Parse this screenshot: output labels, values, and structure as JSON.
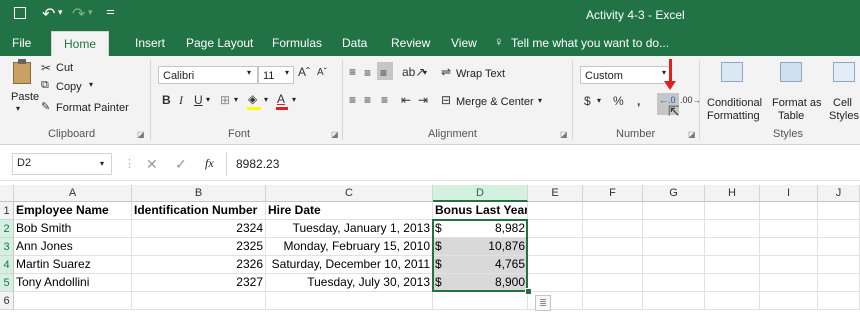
{
  "title_bar": {
    "doc_title": "Activity 4-3 - Excel"
  },
  "tabs": [
    "File",
    "Home",
    "Insert",
    "Page Layout",
    "Formulas",
    "Data",
    "Review",
    "View"
  ],
  "tell_me": "Tell me what you want to do...",
  "ribbon": {
    "clipboard": {
      "paste": "Paste",
      "cut": "Cut",
      "copy": "Copy",
      "format_painter": "Format Painter",
      "group": "Clipboard"
    },
    "font": {
      "name": "Calibri",
      "size": "11",
      "group": "Font"
    },
    "alignment": {
      "wrap_text": "Wrap Text",
      "merge_center": "Merge & Center",
      "group": "Alignment"
    },
    "number": {
      "format": "Custom",
      "group": "Number"
    },
    "styles": {
      "conditional_1": "Conditional",
      "conditional_2": "Formatting",
      "format_as_1": "Format as",
      "format_as_2": "Table",
      "cell_1": "Cell",
      "cell_2": "Styles",
      "group": "Styles"
    }
  },
  "formula_bar": {
    "name_box": "D2",
    "fx": "fx",
    "value": "8982.23"
  },
  "columns": [
    "A",
    "B",
    "C",
    "D",
    "E",
    "F",
    "G",
    "H",
    "I",
    "J"
  ],
  "rows": [
    "1",
    "2",
    "3",
    "4",
    "5",
    "6"
  ],
  "table": {
    "headers": [
      "Employee Name",
      "Identification Number",
      "Hire Date",
      "Bonus Last Year"
    ],
    "data": [
      [
        "Bob Smith",
        "2324",
        "Tuesday, January 1, 2013",
        "$",
        "8,982"
      ],
      [
        "Ann Jones",
        "2325",
        "Monday, February 15, 2010",
        "$",
        "10,876"
      ],
      [
        "Martin Suarez",
        "2326",
        "Saturday, December 10, 2011",
        "$",
        "4,765"
      ],
      [
        "Tony Andollini",
        "2327",
        "Tuesday, July 30, 2013",
        "$",
        "8,900"
      ]
    ]
  },
  "colors": {
    "excel_green": "#217346",
    "selection_fill": "#d9d9d9",
    "arrow_red": "#e02020"
  }
}
